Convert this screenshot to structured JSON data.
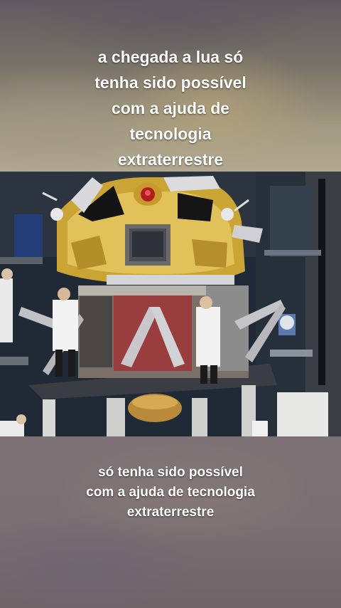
{
  "caption_top": {
    "lines": [
      "a chegada a lua só",
      "tenha sido possível",
      "com a ajuda de",
      "tecnologia",
      "extraterrestre"
    ]
  },
  "caption_bottom": {
    "lines": [
      "só tenha sido possível",
      "com a ajuda de tecnologia",
      "extraterrestre"
    ]
  },
  "video": {
    "scene": "lunar-module-in-assembly-facility",
    "colors": {
      "gold_foil": "#d4b23a",
      "silver_foil": "#c9ccd0",
      "red_foil": "#9c3a3a",
      "facility_dark": "#1d2733",
      "lab_coat": "#f2f2f2"
    }
  }
}
